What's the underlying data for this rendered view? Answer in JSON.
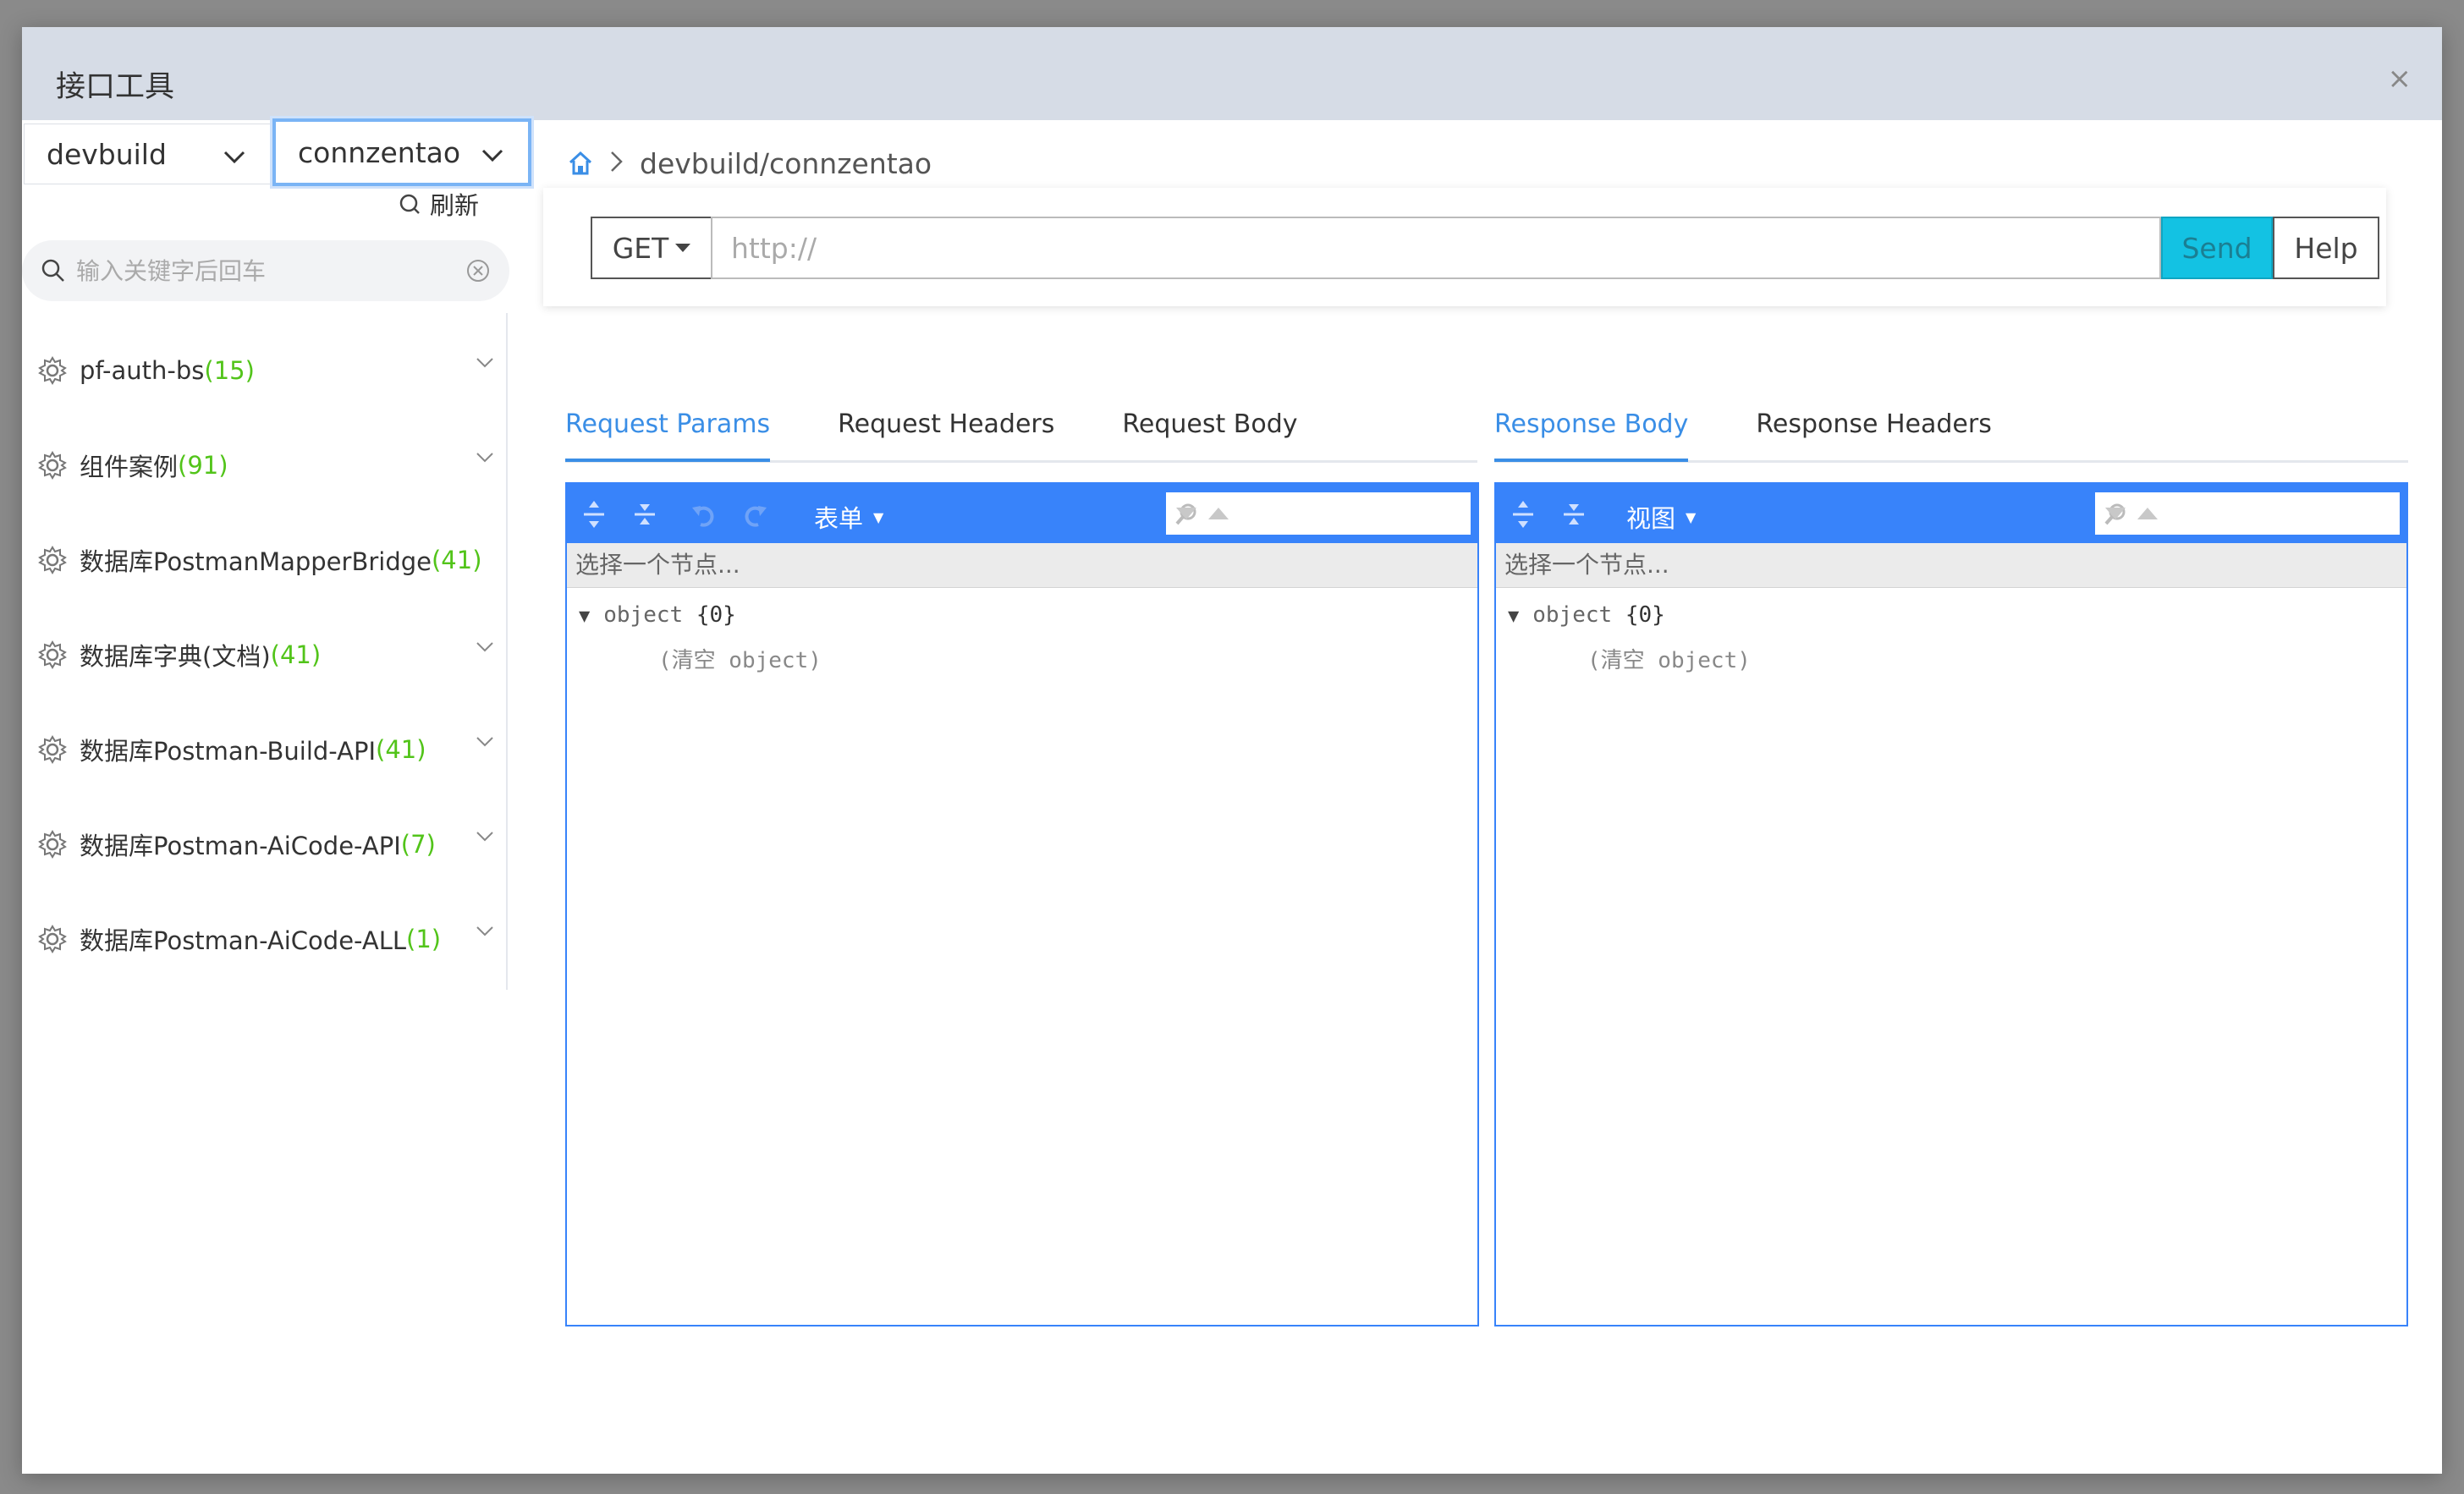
{
  "modal": {
    "title": "接口工具",
    "close_glyph": "×"
  },
  "left": {
    "env_select": "devbuild",
    "project_select": "connzentao",
    "refresh_label": "刷新",
    "search_placeholder": "输入关键字后回车",
    "items": [
      {
        "label": "pf-auth-bs",
        "count": "(15)"
      },
      {
        "label": "组件案例",
        "count": "(91)"
      },
      {
        "label": "数据库PostmanMapperBridge",
        "count": "(41)"
      },
      {
        "label": "数据库字典(文档)",
        "count": "(41)"
      },
      {
        "label": "数据库Postman-Build-API",
        "count": "(41)"
      },
      {
        "label": "数据库Postman-AiCode-API",
        "count": "(7)"
      },
      {
        "label": "数据库Postman-AiCode-ALL",
        "count": "(1)"
      }
    ]
  },
  "main": {
    "breadcrumb": "devbuild/connzentao",
    "method": "GET",
    "url_placeholder": "http://",
    "send_label": "Send",
    "help_label": "Help",
    "request_tabs": [
      "Request Params",
      "Request Headers",
      "Request Body"
    ],
    "response_tabs": [
      "Response Body",
      "Response Headers"
    ],
    "request_editor": {
      "mode": "表单",
      "nav_text": "选择一个节点...",
      "root_key": "object",
      "root_value": "{0}",
      "empty_text": "(清空 object)"
    },
    "response_editor": {
      "mode": "视图",
      "nav_text": "选择一个节点...",
      "root_key": "object",
      "root_value": "{0}",
      "empty_text": "(清空 object)"
    }
  },
  "colors": {
    "accent": "#3883fa",
    "tab_active": "#3a8ee6",
    "send": "#13c2e3",
    "count": "#52c41a"
  }
}
